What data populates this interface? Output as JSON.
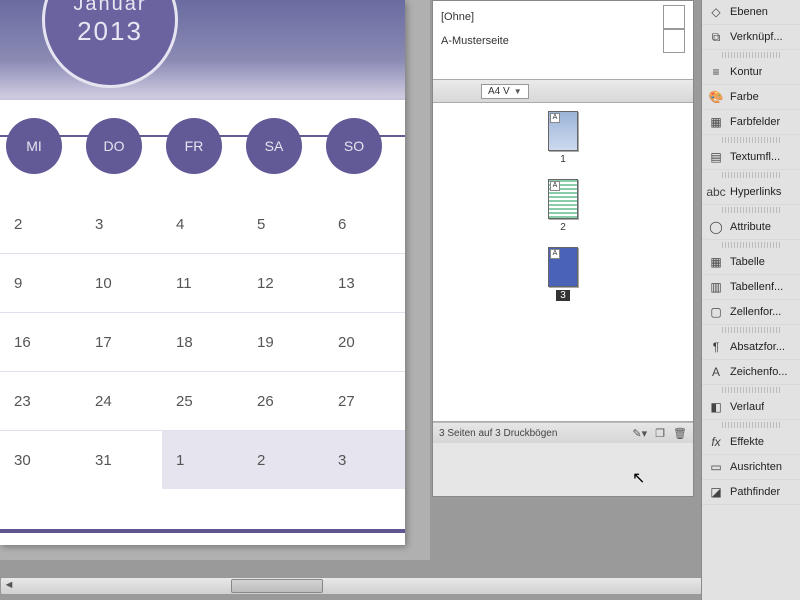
{
  "doc": {
    "month": "Januar",
    "year": "2013",
    "days": [
      "MI",
      "DO",
      "FR",
      "SA",
      "SO"
    ],
    "grid": [
      [
        "2",
        "3",
        "4",
        "5",
        "6"
      ],
      [
        "9",
        "10",
        "11",
        "12",
        "13"
      ],
      [
        "16",
        "17",
        "18",
        "19",
        "20"
      ],
      [
        "23",
        "24",
        "25",
        "26",
        "27"
      ],
      [
        "30",
        "31",
        "1",
        "2",
        "3"
      ]
    ]
  },
  "mastersPanel": {
    "none": "[Ohne]",
    "master": "A-Musterseite"
  },
  "pagesPanel": {
    "sizeSelector": "A4 V",
    "pages": [
      {
        "num": "1",
        "selected": false
      },
      {
        "num": "2",
        "selected": false
      },
      {
        "num": "3",
        "selected": true
      }
    ],
    "status": "3 Seiten auf 3 Druckbögen"
  },
  "panels": {
    "ebenen": "Ebenen",
    "verknupf": "Verknüpf...",
    "kontur": "Kontur",
    "farbe": "Farbe",
    "farbfelder": "Farbfelder",
    "textumfl": "Textumfl...",
    "hyperlinks": "Hyperlinks",
    "attribute": "Attribute",
    "tabelle": "Tabelle",
    "tabellenf": "Tabellenf...",
    "zellenfor": "Zellenfor...",
    "absatzfor": "Absatzfor...",
    "zeichenfo": "Zeichenfo...",
    "verlauf": "Verlauf",
    "effekte": "Effekte",
    "ausrichten": "Ausrichten",
    "pathfinder": "Pathfinder"
  }
}
